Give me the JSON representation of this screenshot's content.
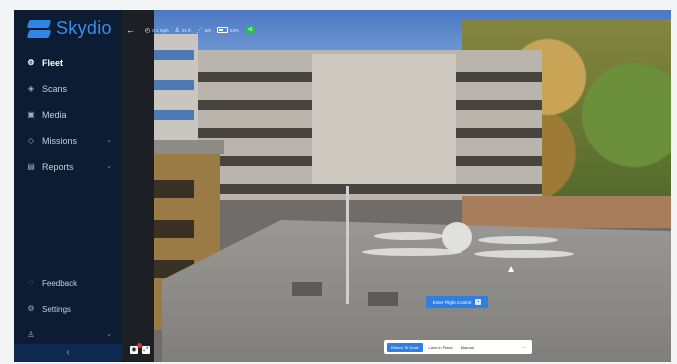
{
  "brand": {
    "name": "Skydio",
    "color": "#3b8cf0"
  },
  "sidebar": {
    "items": [
      {
        "label": "Fleet",
        "icon": "drone-icon",
        "active": true
      },
      {
        "label": "Scans",
        "icon": "scan-icon",
        "active": false
      },
      {
        "label": "Media",
        "icon": "image-icon",
        "active": false
      },
      {
        "label": "Missions",
        "icon": "mission-icon",
        "active": false,
        "expandable": true
      },
      {
        "label": "Reports",
        "icon": "report-icon",
        "active": false,
        "expandable": true
      }
    ],
    "bottom_items": [
      {
        "label": "Feedback",
        "icon": "chat-icon"
      },
      {
        "label": "Settings",
        "icon": "gear-icon"
      },
      {
        "label": "",
        "icon": "user-icon",
        "expandable": true
      }
    ],
    "collapse_glyph": "‹"
  },
  "status": {
    "speed": "0.1 mph",
    "altitude": "21 ft",
    "signal": "5/6",
    "battery": "53%",
    "go_label": "•5"
  },
  "controls": {
    "enter_flight_control": "Enter Flight Control",
    "return_to_dock": "Return To Dock",
    "land_in_place": "Land in Place",
    "manual": "Manual"
  },
  "colors": {
    "accent": "#2f7fe0",
    "sidebar_bg": "#0b1c33",
    "go": "#29c04a"
  }
}
